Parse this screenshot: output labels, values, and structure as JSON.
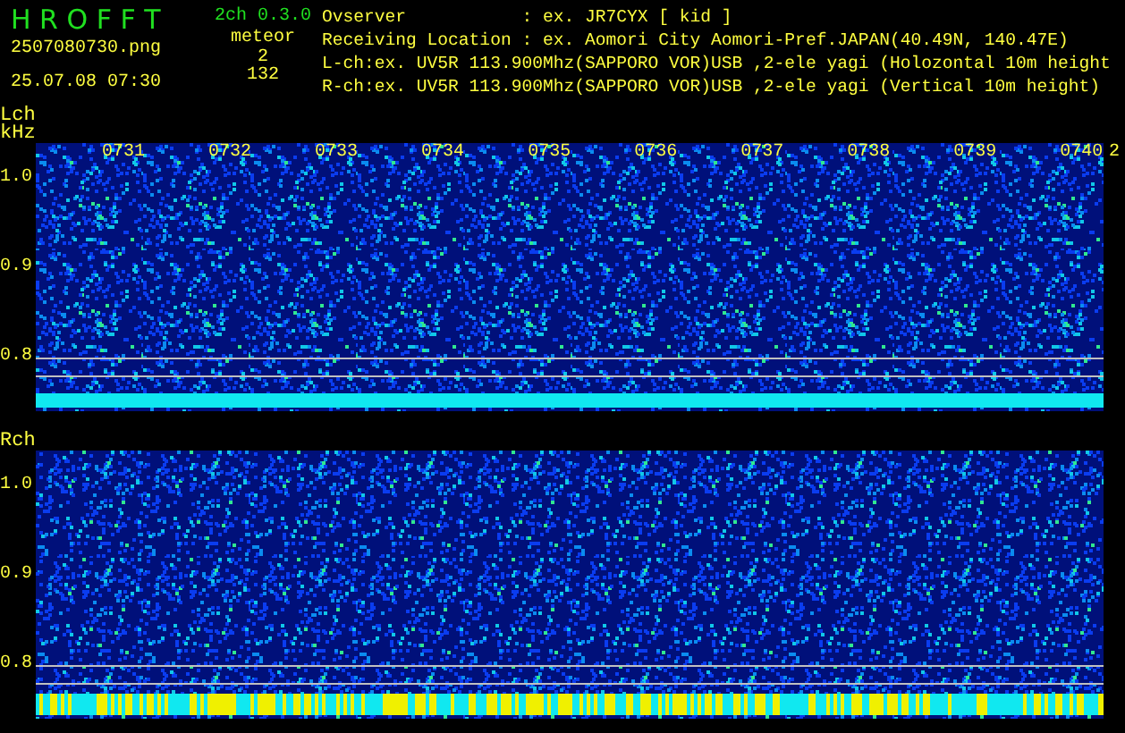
{
  "header": {
    "app_name": "H R O F F T",
    "version": "2ch 0.3.0",
    "filename": "2507080730.png",
    "timestamp": "25.07.08 07:30",
    "mode": "meteor",
    "counts": [
      "2",
      "132"
    ],
    "info_lines": [
      "Ovserver           : ex. JR7CYX [ kid ]",
      "Receiving Location : ex. Aomori City Aomori-Pref.JAPAN(40.49N, 140.47E)",
      "L-ch:ex. UV5R 113.900Mhz(SAPPORO VOR)USB ,2-ele yagi (Holozontal 10m height",
      "R-ch:ex. UV5R 113.900Mhz(SAPPORO VOR)USB ,2-ele yagi (Vertical 10m height)"
    ]
  },
  "channels": [
    {
      "label": "Lch",
      "unit": "kHz",
      "time_labels": [
        "0731",
        "0732",
        "0733",
        "0734",
        "0735",
        "0736",
        "0737",
        "0738",
        "0739",
        "0740"
      ],
      "time_label_overflow": "2",
      "y_labels": [
        "1.0",
        "0.9",
        "0.8"
      ],
      "kind": "cyan"
    },
    {
      "label": "Rch",
      "y_labels": [
        "1.0",
        "0.9",
        "0.8"
      ],
      "kind": "mixed"
    }
  ]
}
